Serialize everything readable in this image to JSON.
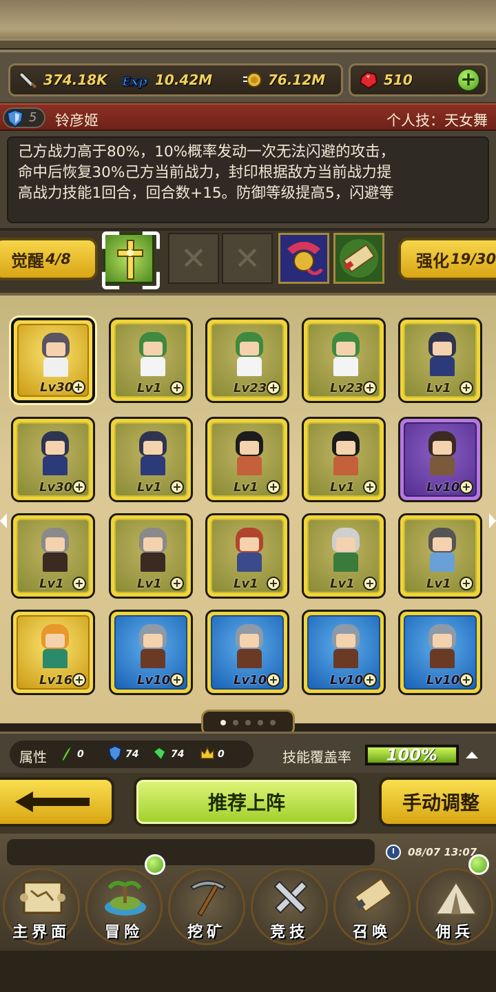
{
  "resources": {
    "power": "374.18K",
    "exp": "10.42M",
    "gold": "76.12M",
    "gems": "510"
  },
  "hero": {
    "level": "5",
    "name": "铃彦姬",
    "skill_title": "个人技：天女舞",
    "description": [
      "己方战力高于80%，10%概率发动一次无法闪避的攻击，",
      "命中后恢复30%己方当前战力，封印根据敌方当前战力提",
      "高战力技能1回合，回合数+15。防御等级提高5，闪避等"
    ]
  },
  "awaken": {
    "label": "觉醒",
    "value": "4/8"
  },
  "enhance": {
    "label": "强化",
    "value": "19/30"
  },
  "slot_icons": [
    "holy-cross-icon",
    "empty-slot-icon",
    "empty-slot-icon",
    "bell-item-icon",
    "scroll-item-icon"
  ],
  "cards": [
    {
      "lv": "Lv30",
      "style": "gold"
    },
    {
      "lv": "Lv1",
      "style": "yellow"
    },
    {
      "lv": "Lv23",
      "style": "yellow"
    },
    {
      "lv": "Lv23",
      "style": "yellow"
    },
    {
      "lv": "Lv1",
      "style": "yellow"
    },
    {
      "lv": "Lv30",
      "style": "yellow"
    },
    {
      "lv": "Lv1",
      "style": "yellow"
    },
    {
      "lv": "Lv1",
      "style": "yellow"
    },
    {
      "lv": "Lv1",
      "style": "yellow"
    },
    {
      "lv": "Lv10",
      "style": "purple"
    },
    {
      "lv": "Lv1",
      "style": "yellow"
    },
    {
      "lv": "Lv1",
      "style": "yellow"
    },
    {
      "lv": "Lv1",
      "style": "yellow"
    },
    {
      "lv": "Lv1",
      "style": "yellow"
    },
    {
      "lv": "Lv1",
      "style": "yellow"
    },
    {
      "lv": "Lv16",
      "style": "gold"
    },
    {
      "lv": "Lv10",
      "style": "blue"
    },
    {
      "lv": "Lv10",
      "style": "blue"
    },
    {
      "lv": "Lv10",
      "style": "blue"
    },
    {
      "lv": "Lv10",
      "style": "blue"
    }
  ],
  "attributes": {
    "label": "属性",
    "values": [
      "0",
      "74",
      "74",
      "0"
    ]
  },
  "coverage": {
    "label": "技能覆盖率",
    "value": "100%"
  },
  "buttons": {
    "recommend": "推荐上阵",
    "manual": "手动调整"
  },
  "time": "08/07 13:07",
  "nav": [
    "主界面",
    "冒险",
    "挖矿",
    "竞技",
    "召唤",
    "佣兵"
  ],
  "colors": {
    "gold": "#f3d25b",
    "accent_green": "#9fcf2a",
    "banner_red": "#8b2f22"
  }
}
